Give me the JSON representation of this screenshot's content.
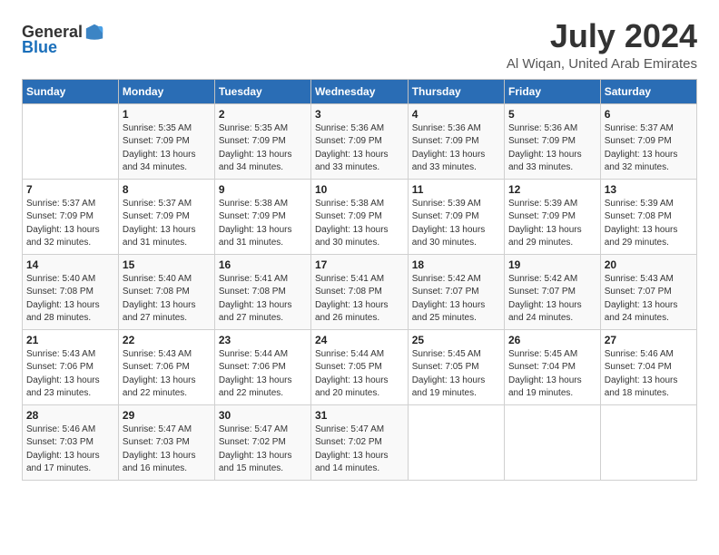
{
  "logo": {
    "text_general": "General",
    "text_blue": "Blue"
  },
  "title": "July 2024",
  "location": "Al Wiqan, United Arab Emirates",
  "days_of_week": [
    "Sunday",
    "Monday",
    "Tuesday",
    "Wednesday",
    "Thursday",
    "Friday",
    "Saturday"
  ],
  "weeks": [
    [
      {
        "day": "",
        "info": ""
      },
      {
        "day": "1",
        "info": "Sunrise: 5:35 AM\nSunset: 7:09 PM\nDaylight: 13 hours\nand 34 minutes."
      },
      {
        "day": "2",
        "info": "Sunrise: 5:35 AM\nSunset: 7:09 PM\nDaylight: 13 hours\nand 34 minutes."
      },
      {
        "day": "3",
        "info": "Sunrise: 5:36 AM\nSunset: 7:09 PM\nDaylight: 13 hours\nand 33 minutes."
      },
      {
        "day": "4",
        "info": "Sunrise: 5:36 AM\nSunset: 7:09 PM\nDaylight: 13 hours\nand 33 minutes."
      },
      {
        "day": "5",
        "info": "Sunrise: 5:36 AM\nSunset: 7:09 PM\nDaylight: 13 hours\nand 33 minutes."
      },
      {
        "day": "6",
        "info": "Sunrise: 5:37 AM\nSunset: 7:09 PM\nDaylight: 13 hours\nand 32 minutes."
      }
    ],
    [
      {
        "day": "7",
        "info": "Sunrise: 5:37 AM\nSunset: 7:09 PM\nDaylight: 13 hours\nand 32 minutes."
      },
      {
        "day": "8",
        "info": "Sunrise: 5:37 AM\nSunset: 7:09 PM\nDaylight: 13 hours\nand 31 minutes."
      },
      {
        "day": "9",
        "info": "Sunrise: 5:38 AM\nSunset: 7:09 PM\nDaylight: 13 hours\nand 31 minutes."
      },
      {
        "day": "10",
        "info": "Sunrise: 5:38 AM\nSunset: 7:09 PM\nDaylight: 13 hours\nand 30 minutes."
      },
      {
        "day": "11",
        "info": "Sunrise: 5:39 AM\nSunset: 7:09 PM\nDaylight: 13 hours\nand 30 minutes."
      },
      {
        "day": "12",
        "info": "Sunrise: 5:39 AM\nSunset: 7:09 PM\nDaylight: 13 hours\nand 29 minutes."
      },
      {
        "day": "13",
        "info": "Sunrise: 5:39 AM\nSunset: 7:08 PM\nDaylight: 13 hours\nand 29 minutes."
      }
    ],
    [
      {
        "day": "14",
        "info": "Sunrise: 5:40 AM\nSunset: 7:08 PM\nDaylight: 13 hours\nand 28 minutes."
      },
      {
        "day": "15",
        "info": "Sunrise: 5:40 AM\nSunset: 7:08 PM\nDaylight: 13 hours\nand 27 minutes."
      },
      {
        "day": "16",
        "info": "Sunrise: 5:41 AM\nSunset: 7:08 PM\nDaylight: 13 hours\nand 27 minutes."
      },
      {
        "day": "17",
        "info": "Sunrise: 5:41 AM\nSunset: 7:08 PM\nDaylight: 13 hours\nand 26 minutes."
      },
      {
        "day": "18",
        "info": "Sunrise: 5:42 AM\nSunset: 7:07 PM\nDaylight: 13 hours\nand 25 minutes."
      },
      {
        "day": "19",
        "info": "Sunrise: 5:42 AM\nSunset: 7:07 PM\nDaylight: 13 hours\nand 24 minutes."
      },
      {
        "day": "20",
        "info": "Sunrise: 5:43 AM\nSunset: 7:07 PM\nDaylight: 13 hours\nand 24 minutes."
      }
    ],
    [
      {
        "day": "21",
        "info": "Sunrise: 5:43 AM\nSunset: 7:06 PM\nDaylight: 13 hours\nand 23 minutes."
      },
      {
        "day": "22",
        "info": "Sunrise: 5:43 AM\nSunset: 7:06 PM\nDaylight: 13 hours\nand 22 minutes."
      },
      {
        "day": "23",
        "info": "Sunrise: 5:44 AM\nSunset: 7:06 PM\nDaylight: 13 hours\nand 22 minutes."
      },
      {
        "day": "24",
        "info": "Sunrise: 5:44 AM\nSunset: 7:05 PM\nDaylight: 13 hours\nand 20 minutes."
      },
      {
        "day": "25",
        "info": "Sunrise: 5:45 AM\nSunset: 7:05 PM\nDaylight: 13 hours\nand 19 minutes."
      },
      {
        "day": "26",
        "info": "Sunrise: 5:45 AM\nSunset: 7:04 PM\nDaylight: 13 hours\nand 19 minutes."
      },
      {
        "day": "27",
        "info": "Sunrise: 5:46 AM\nSunset: 7:04 PM\nDaylight: 13 hours\nand 18 minutes."
      }
    ],
    [
      {
        "day": "28",
        "info": "Sunrise: 5:46 AM\nSunset: 7:03 PM\nDaylight: 13 hours\nand 17 minutes."
      },
      {
        "day": "29",
        "info": "Sunrise: 5:47 AM\nSunset: 7:03 PM\nDaylight: 13 hours\nand 16 minutes."
      },
      {
        "day": "30",
        "info": "Sunrise: 5:47 AM\nSunset: 7:02 PM\nDaylight: 13 hours\nand 15 minutes."
      },
      {
        "day": "31",
        "info": "Sunrise: 5:47 AM\nSunset: 7:02 PM\nDaylight: 13 hours\nand 14 minutes."
      },
      {
        "day": "",
        "info": ""
      },
      {
        "day": "",
        "info": ""
      },
      {
        "day": "",
        "info": ""
      }
    ]
  ]
}
